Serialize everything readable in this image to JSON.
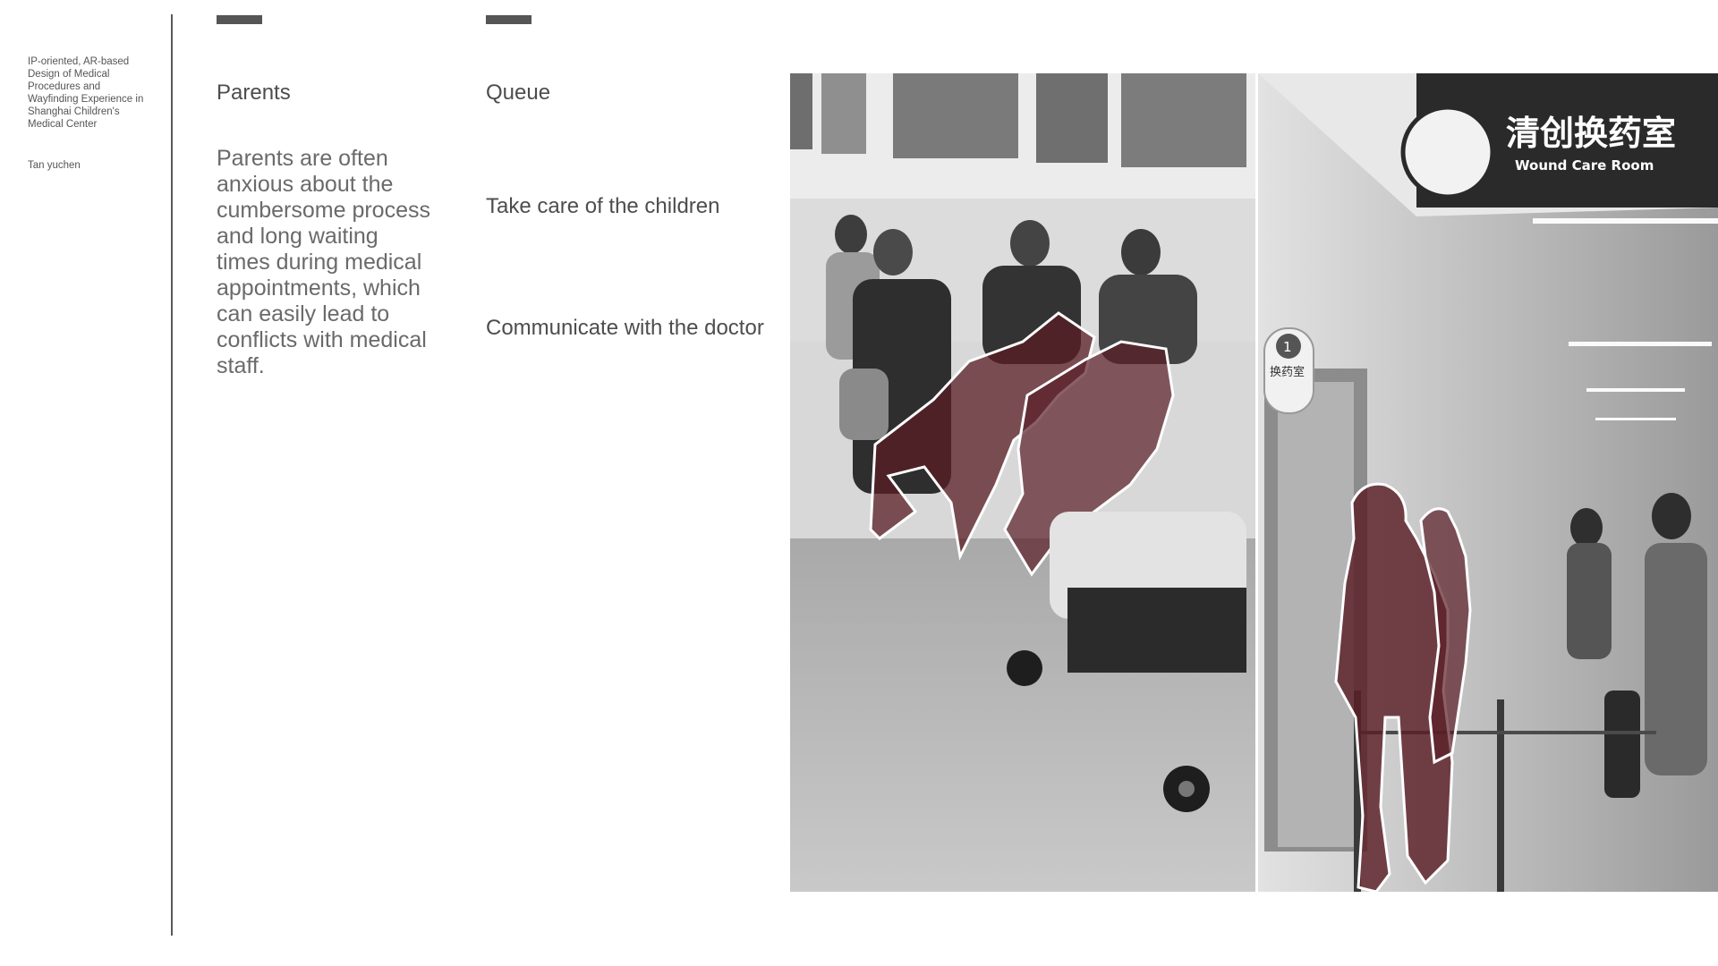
{
  "sidebar": {
    "project_title": "IP-oriented, AR-based Design of Medical Procedures and Wayfinding Experience in Shanghai Children's Medical Center",
    "author": "Tan yuchen"
  },
  "column_parents": {
    "heading": "Parents",
    "body": "Parents are often anxious about the cumbersome process and long waiting times during medical appointments, which can easily lead to conflicts with medical staff."
  },
  "column_queue": {
    "heading": "Queue",
    "item_1": "Take care of the children",
    "item_2": "Communicate with the doctor"
  },
  "photo": {
    "sign_chinese": "清创换药室",
    "sign_english": "Wound Care Room",
    "room_sign": "换药室",
    "room_number": "1",
    "highlight_color": "#5a1e26"
  }
}
